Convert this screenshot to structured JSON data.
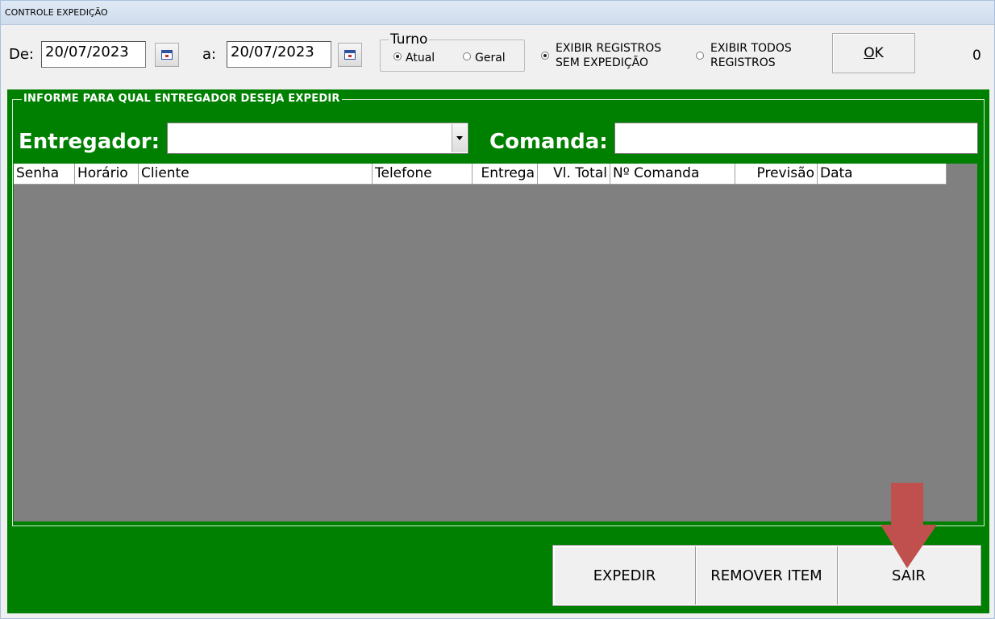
{
  "window": {
    "title": "CONTROLE EXPEDIÇÃO"
  },
  "toolbar": {
    "from_label": "De:",
    "from_date": "20/07/2023",
    "to_label": "a:",
    "to_date": "20/07/2023",
    "turno": {
      "title": "Turno",
      "options": [
        {
          "label": "Atual",
          "selected": true
        },
        {
          "label": "Geral",
          "selected": false
        }
      ]
    },
    "filter_options": [
      {
        "line1": "EXIBIR REGISTROS",
        "line2": "SEM EXPEDIÇÃO",
        "selected": true
      },
      {
        "line1": "EXIBIR TODOS",
        "line2": "REGISTROS",
        "selected": false
      }
    ],
    "ok_label_underlined": "O",
    "ok_label_rest": "K",
    "count": "0"
  },
  "panel": {
    "frame_title": "INFORME PARA QUAL ENTREGADOR DESEJA EXPEDIR",
    "entregador_label": "Entregador:",
    "entregador_value": "",
    "comanda_label": "Comanda:",
    "comanda_value": ""
  },
  "grid": {
    "columns": [
      "Senha",
      "Horário",
      "Cliente",
      "Telefone",
      "Entrega",
      "Vl. Total",
      "Nº Comanda",
      "Previsão",
      "Data"
    ],
    "rows": []
  },
  "actions": {
    "expedir": "EXPEDIR",
    "remover": "REMOVER ITEM",
    "sair": "SAIR"
  },
  "colors": {
    "panel_green": "#008000",
    "grid_bg": "#808080",
    "arrow": "#c0504d"
  }
}
